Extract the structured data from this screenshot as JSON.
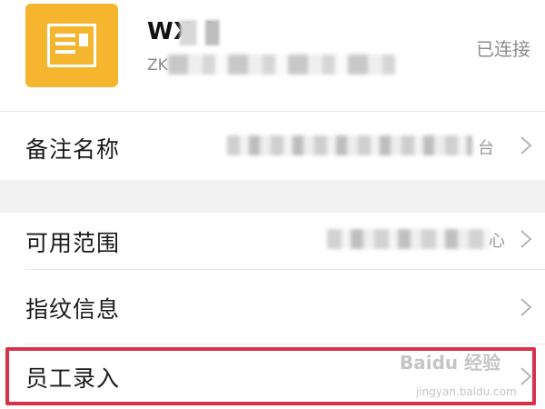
{
  "device": {
    "name": "WX       0",
    "subtitle": "ZK",
    "status": "已连接",
    "accent_color": "#f5b52e"
  },
  "rows": [
    {
      "label": "备注名称",
      "value": "台"
    },
    {
      "label": "可用范围",
      "value": "心"
    },
    {
      "label": "指纹信息",
      "value": ""
    },
    {
      "label": "员工录入",
      "value": ""
    }
  ],
  "highlight_color": "#d6324a",
  "watermark": {
    "text": "Baidu 经验",
    "sub": "jingyan.baidu.com"
  }
}
